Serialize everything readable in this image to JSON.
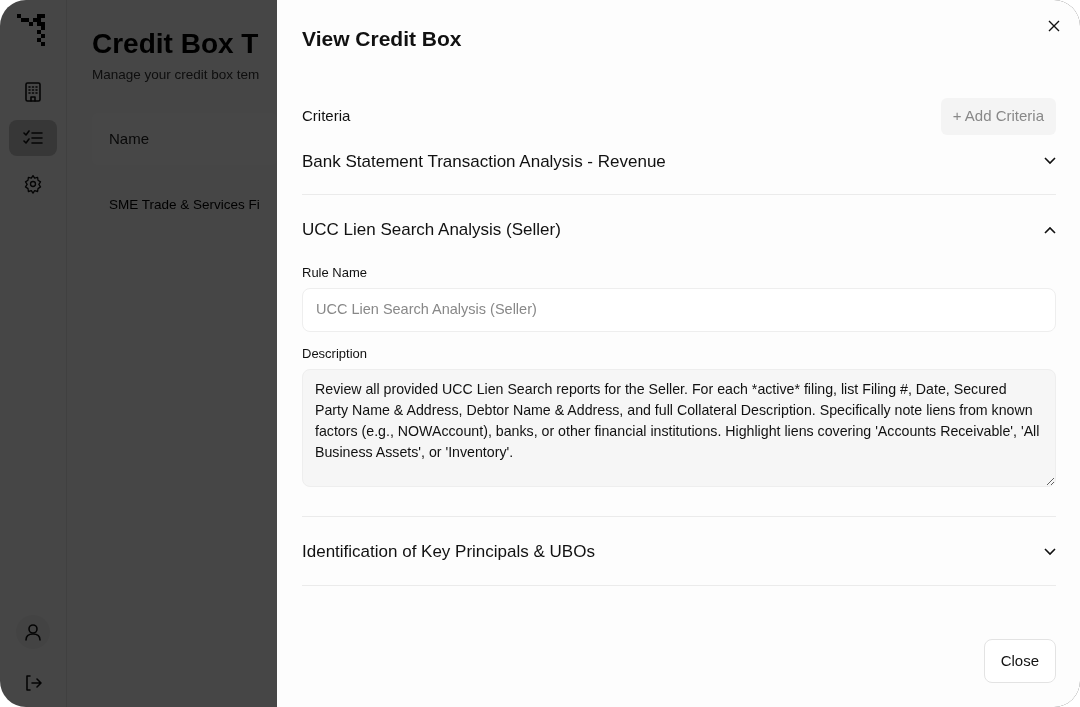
{
  "background": {
    "sidebar": {
      "items": [
        {
          "selected": false
        },
        {
          "selected": true
        },
        {
          "selected": false
        }
      ]
    },
    "title": "Credit Box T",
    "subtitle": "Manage your credit box tem",
    "table": {
      "columns": [
        "Name"
      ],
      "rows": [
        "SME Trade & Services Fi"
      ]
    }
  },
  "drawer": {
    "title": "View Credit Box",
    "section_label": "Criteria",
    "add_button": "+ Add Criteria",
    "criteria": [
      {
        "title": "Bank Statement Transaction Analysis - Revenue",
        "expanded": false
      },
      {
        "title": "UCC Lien Search Analysis (Seller)",
        "expanded": true,
        "rule_name_label": "Rule Name",
        "rule_name": "UCC Lien Search Analysis (Seller)",
        "description_label": "Description",
        "description": "Review all provided UCC Lien Search reports for the Seller. For each *active* filing, list Filing #, Date, Secured Party Name & Address, Debtor Name & Address, and full Collateral Description. Specifically note liens from known factors (e.g., NOWAccount), banks, or other financial institutions. Highlight liens covering 'Accounts Receivable', 'All Business Assets', or 'Inventory'."
      },
      {
        "title": "Identification of Key Principals & UBOs",
        "expanded": false
      }
    ],
    "close_button": "Close"
  }
}
